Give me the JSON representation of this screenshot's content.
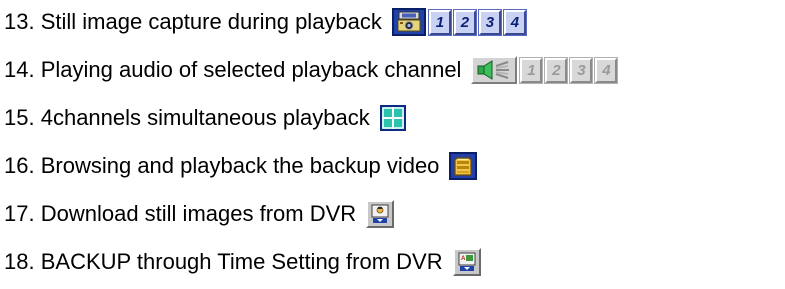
{
  "items": [
    {
      "number": "13.",
      "text": "Still image capture during playback",
      "icon": "camera-capture-icon"
    },
    {
      "number": "14.",
      "text": "Playing audio of selected playback channel",
      "icon": "speaker-audio-icon"
    },
    {
      "number": "15.",
      "text": "4channels simultaneous playback",
      "icon": "quad-view-icon"
    },
    {
      "number": "16.",
      "text": "Browsing and playback the backup video",
      "icon": "backup-drive-icon"
    },
    {
      "number": "17.",
      "text": "Download still images from DVR",
      "icon": "download-image-icon"
    },
    {
      "number": "18.",
      "text": " BACKUP through Time Setting from DVR",
      "icon": "download-time-backup-icon"
    }
  ],
  "capture_channels": [
    "1",
    "2",
    "3",
    "4"
  ],
  "audio_channels": [
    "1",
    "2",
    "3",
    "4"
  ],
  "colors": {
    "button_blue": "#1f43a8",
    "channel_active": "#c9d2f2",
    "channel_inactive": "#d8d8d8",
    "quad_teal": "#2bc2b0",
    "text": "#000000"
  }
}
